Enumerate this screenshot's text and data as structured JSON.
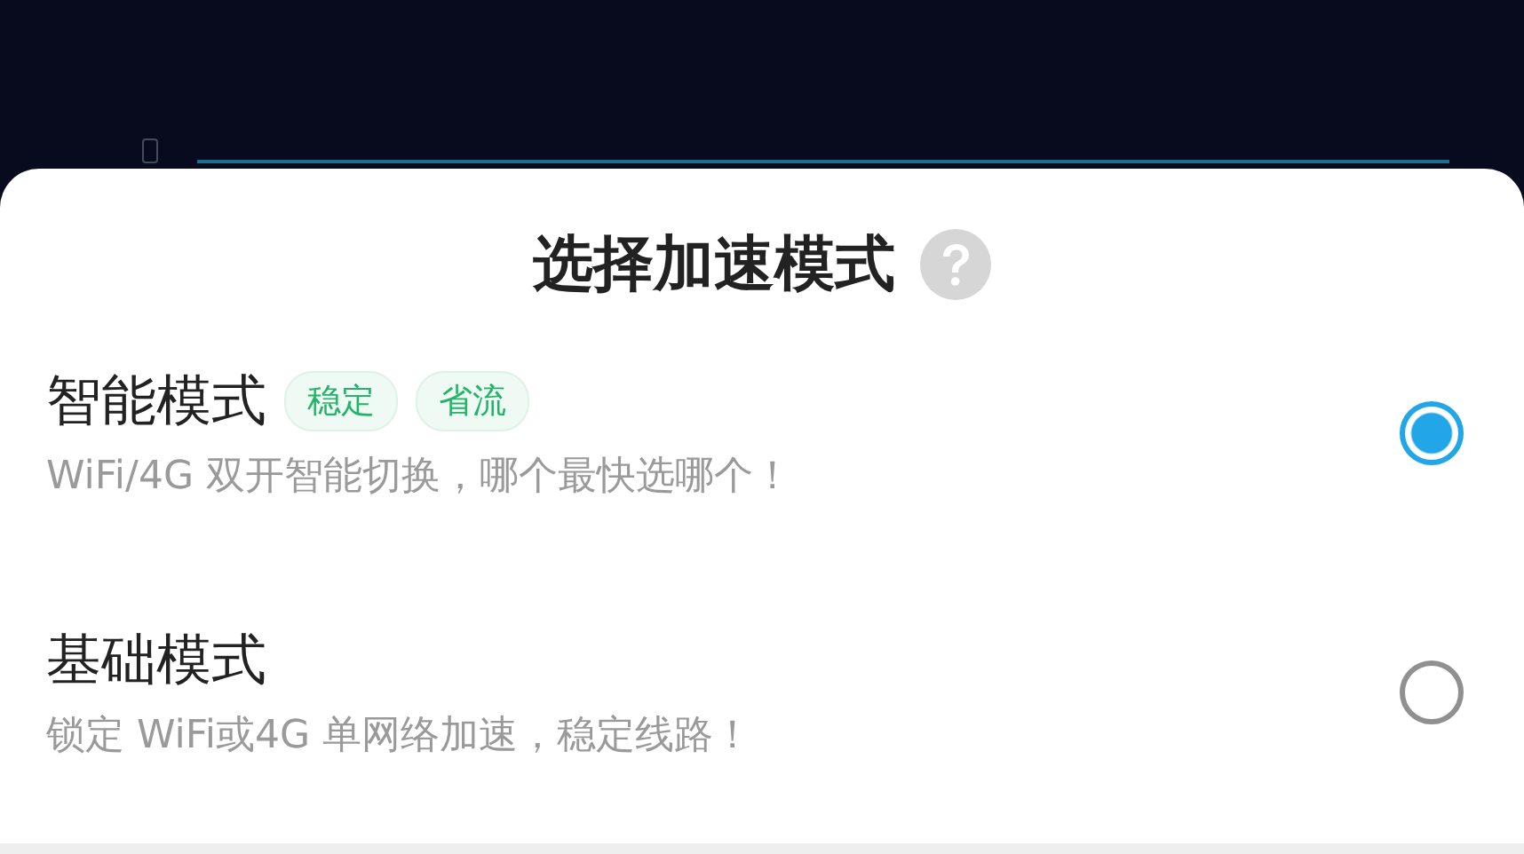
{
  "sheet": {
    "title": "选择加速模式"
  },
  "modes": [
    {
      "name": "智能模式",
      "tags": [
        "稳定",
        "省流"
      ],
      "description": "WiFi/4G 双开智能切换，哪个最快选哪个！",
      "selected": true
    },
    {
      "name": "基础模式",
      "description": "锁定 WiFi或4G 单网络加速，稳定线路！",
      "selected": false
    }
  ]
}
